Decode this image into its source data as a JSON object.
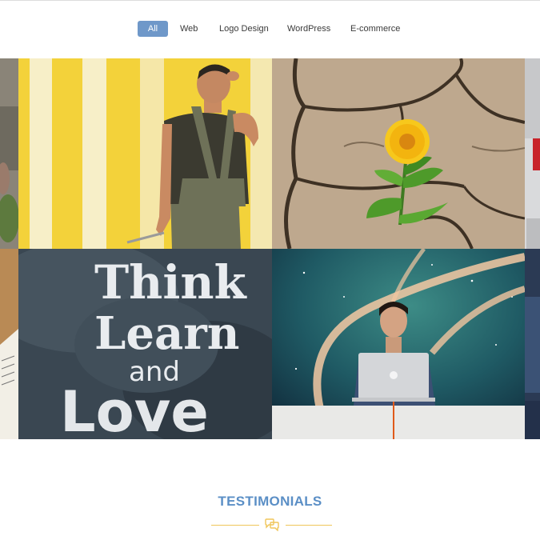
{
  "filters": {
    "items": [
      "All",
      "Web",
      "Logo Design",
      "WordPress",
      "E-commerce"
    ],
    "active": "All"
  },
  "gallery": {
    "tiles": [
      {
        "name": "portfolio-tile-partial-left-top",
        "subject": "partial-photo"
      },
      {
        "name": "portfolio-tile-painter",
        "subject": "man-painting-yellow-wall"
      },
      {
        "name": "portfolio-tile-flower",
        "subject": "flower-on-cracked-earth"
      },
      {
        "name": "portfolio-tile-partial-right-top",
        "subject": "partial-photo"
      },
      {
        "name": "portfolio-tile-partial-left-bottom",
        "subject": "partial-photo"
      },
      {
        "name": "portfolio-tile-chalkboard",
        "subject": "chalkboard-lettering"
      },
      {
        "name": "portfolio-tile-laptop",
        "subject": "man-with-laptop-space"
      },
      {
        "name": "portfolio-tile-partial-right-bottom",
        "subject": "partial-photo"
      }
    ],
    "chalkboard_text": [
      "Think",
      "Learn",
      "and",
      "Love"
    ]
  },
  "testimonials": {
    "title": "TESTIMONIALS",
    "icon": "speech-bubbles-icon",
    "accent_color": "#f0c65a",
    "title_color": "#5b8fc6"
  },
  "colors": {
    "filter_active_bg": "#6f98c9"
  }
}
